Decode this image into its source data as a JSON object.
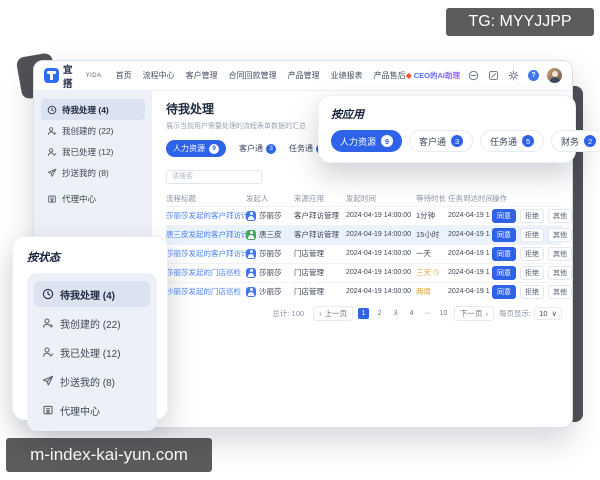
{
  "overlay_badges": {
    "tg": "TG: MYYJJPP",
    "domain": "m-index-kai-yun.com"
  },
  "navbar": {
    "logo_cn": "宜搭",
    "logo_en": "YIDA",
    "menu": [
      "首页",
      "流程中心",
      "客户管理",
      "合同回款管理",
      "产品管理",
      "业绩报表",
      "产品售后"
    ],
    "ai_badge": "CEO的AI助理"
  },
  "sidebar": {
    "items": [
      "待我处理 (4)",
      "我创建的 (22)",
      "我已处理 (12)",
      "抄送我的 (8)",
      "代理中心"
    ]
  },
  "main": {
    "title": "待我处理",
    "subtitle": "展示当前用户需要处理的流程表单数据的汇总",
    "search_placeholder": "请搜索",
    "tabs": [
      {
        "label": "人力资源",
        "count": "9"
      },
      {
        "label": "客户通",
        "count": "3"
      },
      {
        "label": "任务通",
        "count": "5"
      },
      {
        "label": "财务",
        "count": "2"
      }
    ]
  },
  "table": {
    "headers": [
      "流程标题",
      "发起人",
      "来源应用",
      "发起时间",
      "等待时长",
      "任务到达时间",
      "操作"
    ],
    "rows": [
      {
        "title": "莎丽莎发起的客户拜访计划",
        "starter": "莎丽莎",
        "app": "客户拜访管理",
        "start": "2024-04-19 14:00:00",
        "wait": "1分钟",
        "arrive": "2024-04-19 1"
      },
      {
        "title": "唐三皮发起的客户拜访计划",
        "starter": "唐三皮",
        "app": "客户拜访管理",
        "start": "2024-04-19 14:00:00",
        "wait": "15小时",
        "arrive": "2024-04-19 1"
      },
      {
        "title": "莎丽莎发起的客户拜访计划",
        "starter": "莎丽莎",
        "app": "门店管理",
        "start": "2024-04-19 14:00:00",
        "wait": "一天",
        "arrive": "2024-04-19 1"
      },
      {
        "title": "莎丽莎发起的门店巡检",
        "starter": "莎丽莎",
        "app": "门店管理",
        "start": "2024-04-19 14:00:00",
        "wait": "三天",
        "arrive": "2024-04-19 1"
      },
      {
        "title": "沙丽莎发起的门店巡检",
        "starter": "沙丽莎",
        "app": "门店管理",
        "start": "2024-04-19 14:00:00",
        "wait": "两周",
        "arrive": "2024-04-19 1"
      }
    ],
    "actions": {
      "approve": "同意",
      "reject": "拒绝",
      "other": "其他",
      "more": "···"
    }
  },
  "pagination": {
    "total": "总计: 100",
    "prev": "上一页",
    "next": "下一页",
    "pages": [
      "1",
      "2",
      "3",
      "4",
      "···",
      "10"
    ],
    "per_label": "每页显示:",
    "per_value": "10",
    "arrow_left": "‹",
    "arrow_right": "›",
    "caret": "∨"
  },
  "status_panel": {
    "title": "按状态",
    "items": [
      "待我处理 (4)",
      "我创建的 (22)",
      "我已处理 (12)",
      "抄送我的 (8)",
      "代理中心"
    ]
  },
  "app_panel": {
    "title": "按应用",
    "tabs": [
      {
        "label": "人力资源",
        "count": "9"
      },
      {
        "label": "客户通",
        "count": "3"
      },
      {
        "label": "任务通",
        "count": "5"
      },
      {
        "label": "财务",
        "count": "2"
      }
    ]
  },
  "colors": {
    "accent": "#2e62e9",
    "link": "#4b83f7",
    "warning": "#e8a23d",
    "sidebar_bg": "#edf0f7"
  }
}
